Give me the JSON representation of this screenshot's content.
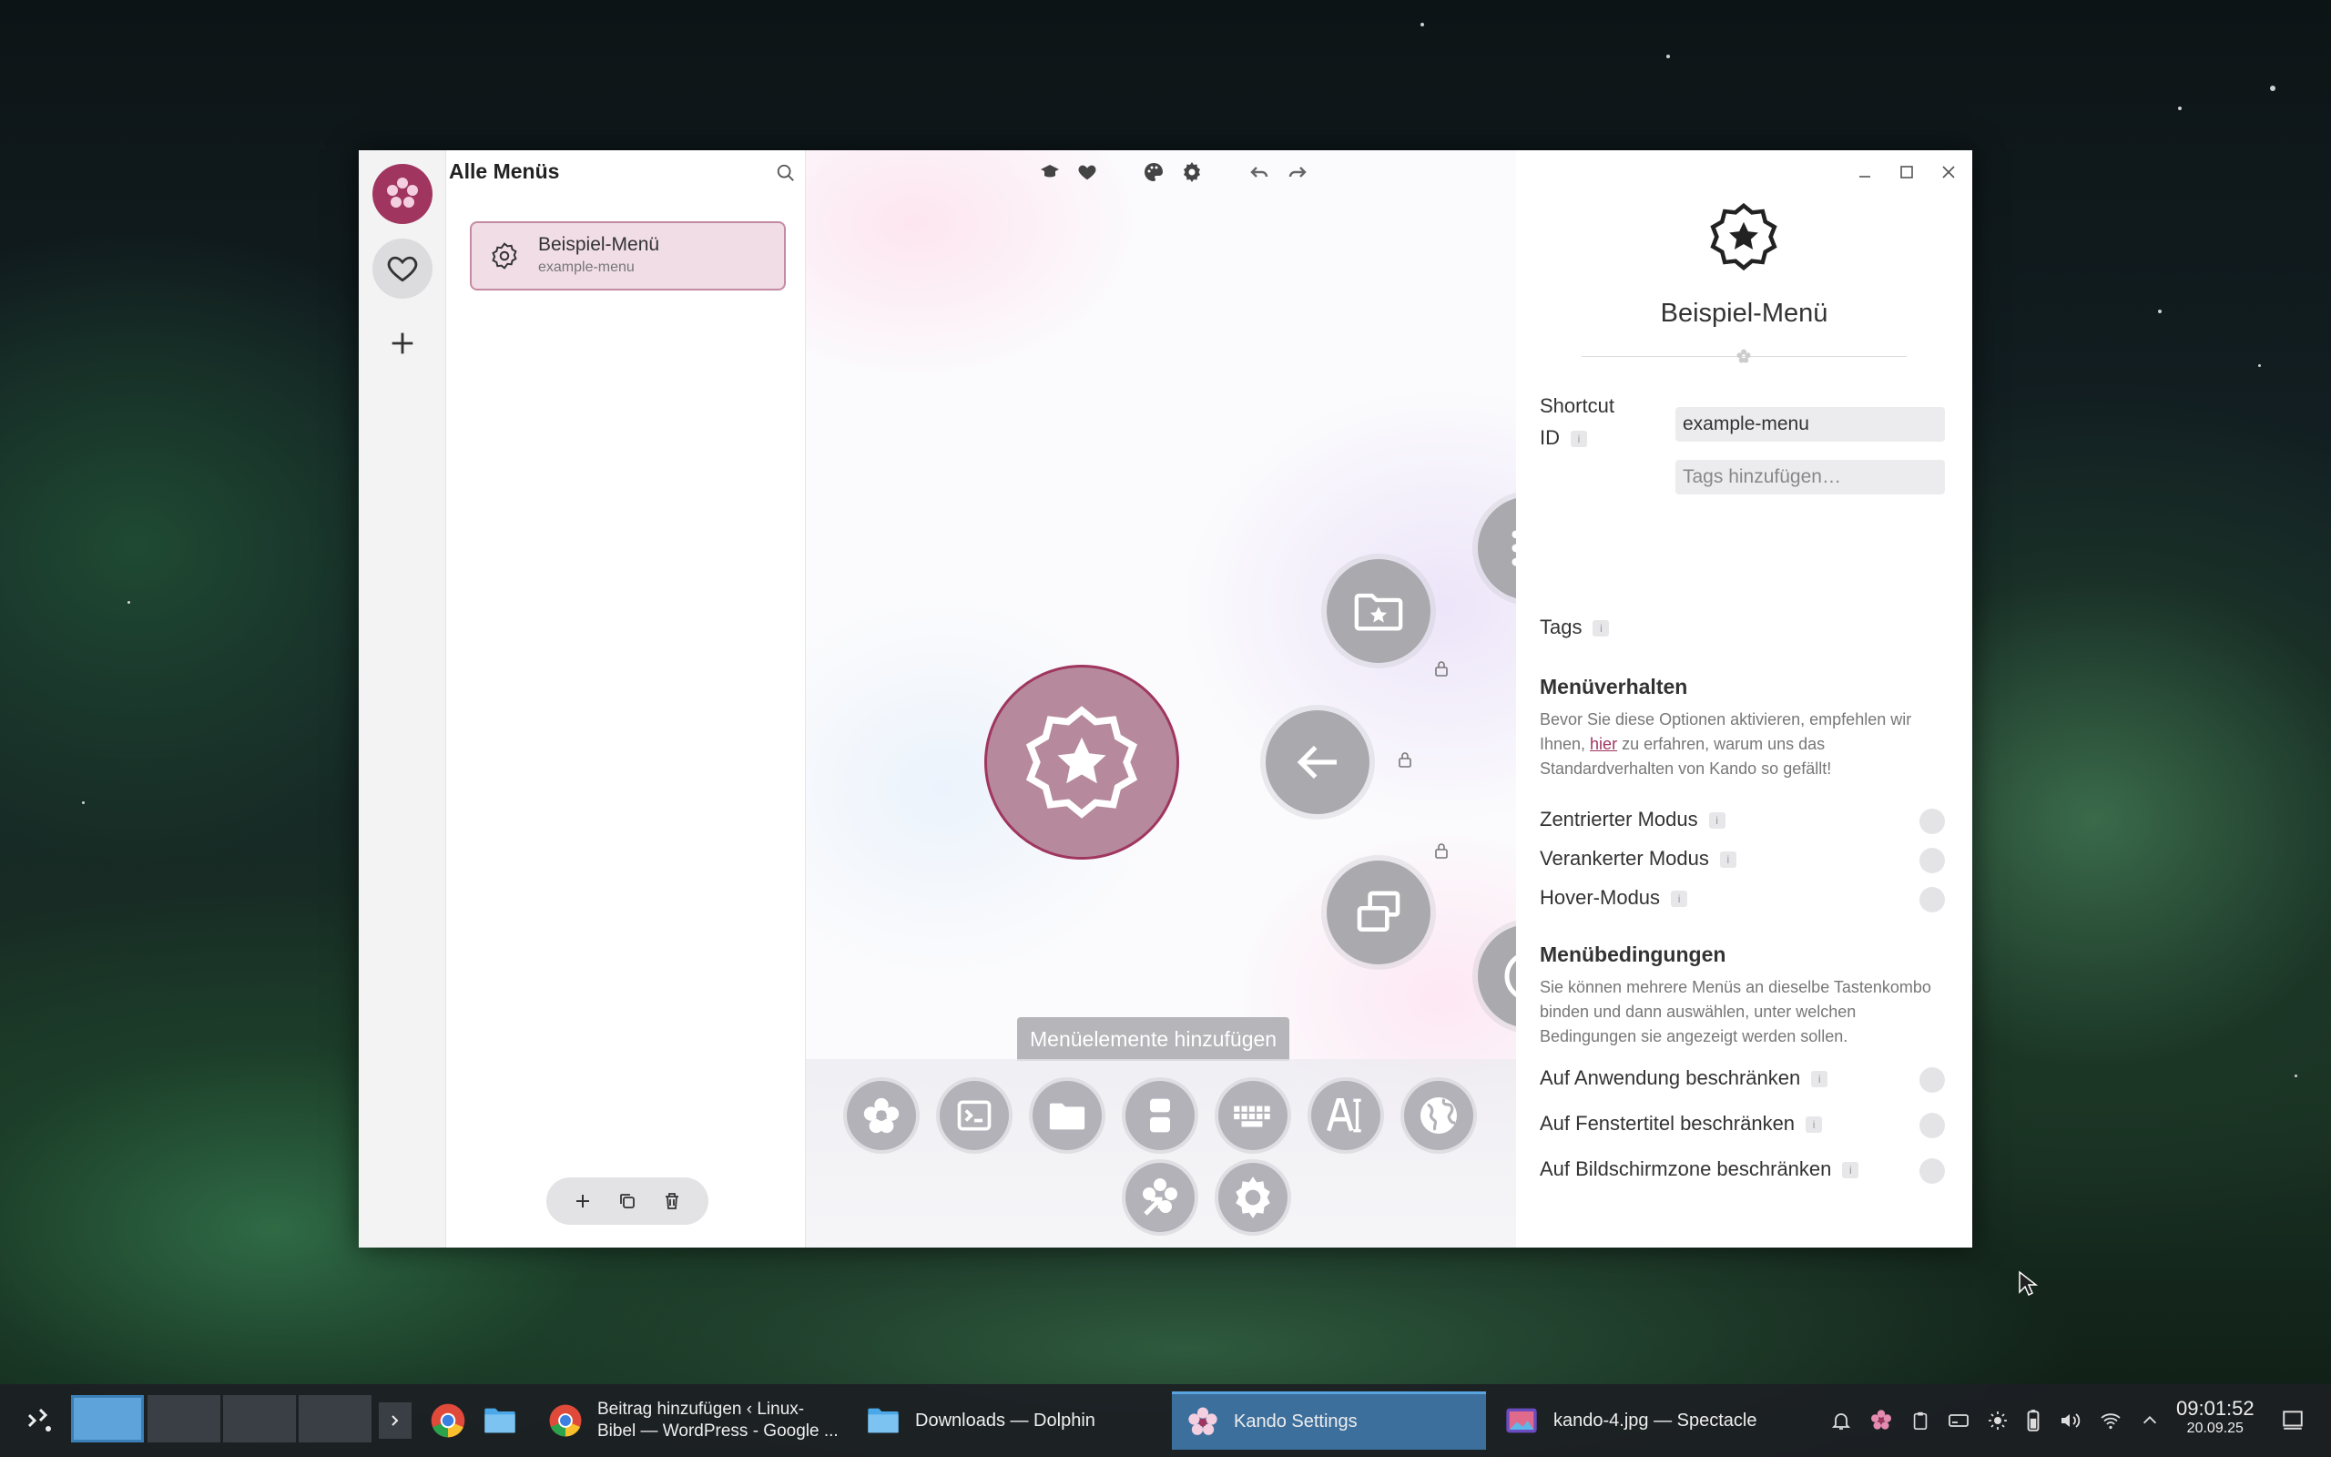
{
  "sidebar": {
    "title": "Alle Menüs",
    "menus": [
      {
        "name": "Beispiel-Menü",
        "shortcut_id": "example-menu"
      }
    ]
  },
  "palette": {
    "tooltip": "Menüelemente hinzufügen"
  },
  "properties": {
    "menu_name": "Beispiel-Menü",
    "shortcut_label_1": "Shortcut",
    "shortcut_label_2": "ID",
    "shortcut_value": "example-menu",
    "tags_label": "Tags",
    "tags_placeholder": "Tags hinzufügen…",
    "behavior_heading": "Menüverhalten",
    "behavior_desc_1": "Bevor Sie diese Optionen aktivieren, empfehlen wir Ihnen, ",
    "behavior_desc_link": "hier",
    "behavior_desc_2": " zu erfahren, warum uns das Standardverhalten von Kando so gefällt!",
    "toggle_centered": "Zentrierter Modus",
    "toggle_anchored": "Verankerter Modus",
    "toggle_hover": "Hover-Modus",
    "conditions_heading": "Menübedingungen",
    "conditions_desc": "Sie können mehrere Menüs an dieselbe Tastenkombo binden und dann auswählen, unter welchen Bedingungen sie angezeigt werden sollen.",
    "cond_app": "Auf Anwendung beschränken",
    "cond_title": "Auf Fenstertitel beschränken",
    "cond_zone": "Auf Bildschirmzone beschränken"
  },
  "taskbar": {
    "tasks": [
      {
        "label_1": "Beitrag hinzufügen ‹ Linux-",
        "label_2": "Bibel — WordPress - Google ..."
      },
      {
        "label": "Downloads — Dolphin"
      },
      {
        "label": "Kando Settings"
      },
      {
        "label": "kando-4.jpg — Spectacle"
      }
    ],
    "time": "09:01:52",
    "date": "20.09.25"
  },
  "colors": {
    "accent": "#a0365f",
    "node": "#a9a9ae",
    "taskbar_active": "#3d6f9c"
  },
  "icons": {
    "rail": [
      "kando-flower-icon",
      "heart-icon",
      "plus-icon"
    ],
    "toolbar": [
      "graduation-cap-icon",
      "heart-icon",
      "palette-icon",
      "gear-icon",
      "undo-icon",
      "redo-icon"
    ],
    "menu_nodes": [
      "apps-grid-icon",
      "globe-icon",
      "arrow-right-icon",
      "clipboard-icon",
      "play-icon",
      "windows-icon",
      "arrow-left-icon",
      "folder-star-icon"
    ],
    "center": "badge-star-icon",
    "palette_items": [
      "flower-icon",
      "terminal-icon",
      "folder-icon",
      "alt-f4-hotkey-icon",
      "keyboard-icon",
      "text-insert-icon",
      "globe-icon",
      "redirect-icon",
      "settings-icon"
    ]
  }
}
